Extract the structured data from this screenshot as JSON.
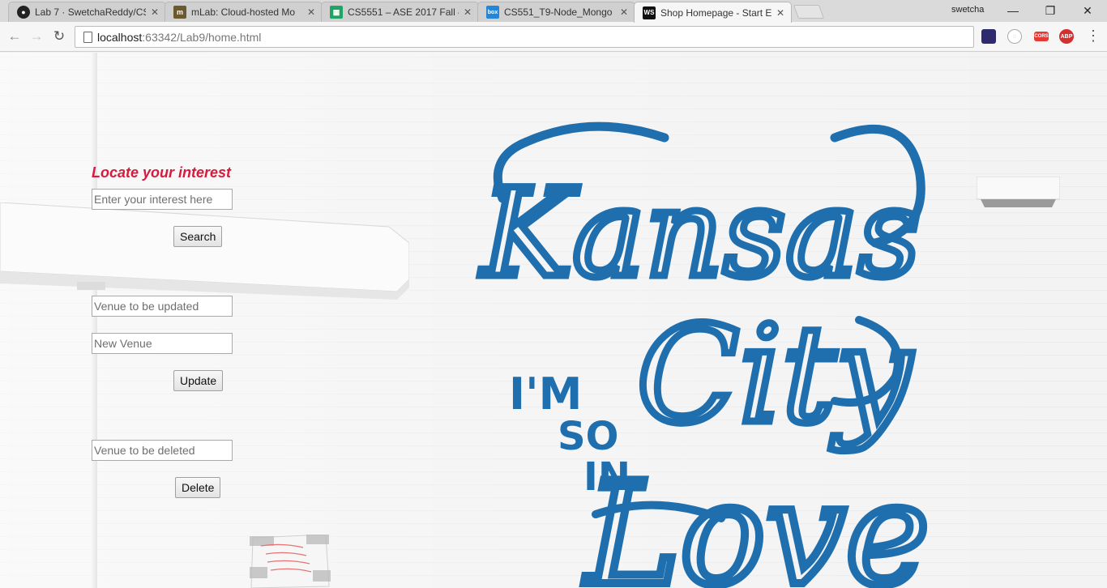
{
  "browser": {
    "tabs": [
      {
        "title": "Lab 7 · SwetchaReddy/CS",
        "favicon": "github-icon",
        "active": false
      },
      {
        "title": "mLab: Cloud-hosted Mo",
        "favicon": "mlab-icon",
        "active": false
      },
      {
        "title": "CS5551 – ASE 2017 Fall –",
        "favicon": "sheets-icon",
        "active": false
      },
      {
        "title": "CS551_T9-Node_Mongo",
        "favicon": "box-icon",
        "active": false
      },
      {
        "title": "Shop Homepage - Start E",
        "favicon": "webstorm-icon",
        "active": true
      }
    ],
    "profile_name": "swetcha",
    "url_host": "localhost",
    "url_rest": ":63342/Lab9/home.html",
    "extensions": [
      "vpn-icon",
      "ghostery-icon",
      "color-icon",
      "adblock-icon"
    ],
    "ext_labels": {
      "adblock": "ABP",
      "color": "CORS"
    }
  },
  "page": {
    "search": {
      "heading": "Locate your interest",
      "placeholder": "Enter your interest here",
      "button": "Search"
    },
    "update": {
      "old_placeholder": "Venue to be updated",
      "new_placeholder": "New Venue",
      "button": "Update"
    },
    "delete": {
      "placeholder": "Venue to be deleted",
      "button": "Delete"
    },
    "mural": {
      "word1": "Kansas",
      "word2": "I'M",
      "word3": "SO",
      "word4": "IN",
      "word5": "City",
      "word6": "Love"
    }
  },
  "colors": {
    "heading": "#d81b3c",
    "mural_blue": "#1f6fae"
  }
}
